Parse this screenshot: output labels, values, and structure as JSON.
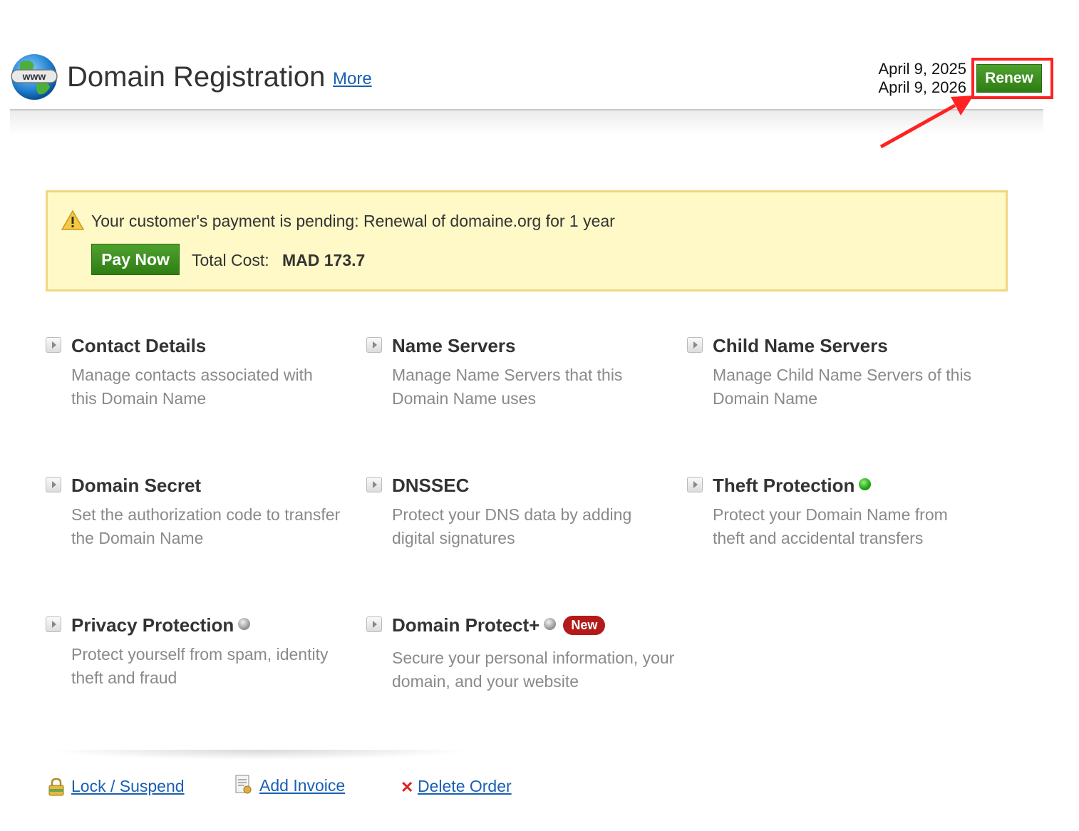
{
  "header": {
    "title": "Domain Registration",
    "more_label": "More",
    "globe_text": "www",
    "date_start": "April 9, 2025",
    "date_end": "April 9, 2026",
    "renew_label": "Renew"
  },
  "alert": {
    "message": "Your customer's payment is pending: Renewal of domaine.org for 1 year",
    "pay_label": "Pay Now",
    "cost_label": "Total Cost:",
    "cost_value": "MAD 173.7"
  },
  "features": [
    {
      "title": "Contact Details",
      "desc": "Manage contacts associated with this Domain Name"
    },
    {
      "title": "Name Servers",
      "desc": "Manage Name Servers that this Domain Name uses"
    },
    {
      "title": "Child Name Servers",
      "desc": "Manage Child Name Servers of this Domain Name"
    },
    {
      "title": "Domain Secret",
      "desc": "Set the authorization code to transfer the Domain Name"
    },
    {
      "title": "DNSSEC",
      "desc": "Protect your DNS data by adding digital signatures"
    },
    {
      "title": "Theft Protection",
      "desc": "Protect your Domain Name from theft and accidental transfers",
      "status": "green"
    },
    {
      "title": "Privacy Protection",
      "desc": "Protect yourself from spam, identity theft and fraud",
      "status": "grey"
    },
    {
      "title": "Domain Protect+",
      "desc": "Secure your personal information, your domain, and your website",
      "status": "grey",
      "badge": "New"
    }
  ],
  "footer": {
    "lock_label": "Lock / Suspend",
    "invoice_label": "Add Invoice",
    "delete_label": "Delete Order"
  },
  "icons": {
    "globe": "globe-www-icon",
    "warning": "warning-icon",
    "lock": "lock-icon",
    "invoice": "invoice-icon",
    "delete": "delete-x-icon"
  },
  "colors": {
    "button_green": "#3a8f1f",
    "alert_bg": "#fef9c7",
    "alert_border": "#f2d67f",
    "link": "#1a5fb4",
    "highlight": "#ff2222",
    "badge_red": "#b41a1a"
  }
}
